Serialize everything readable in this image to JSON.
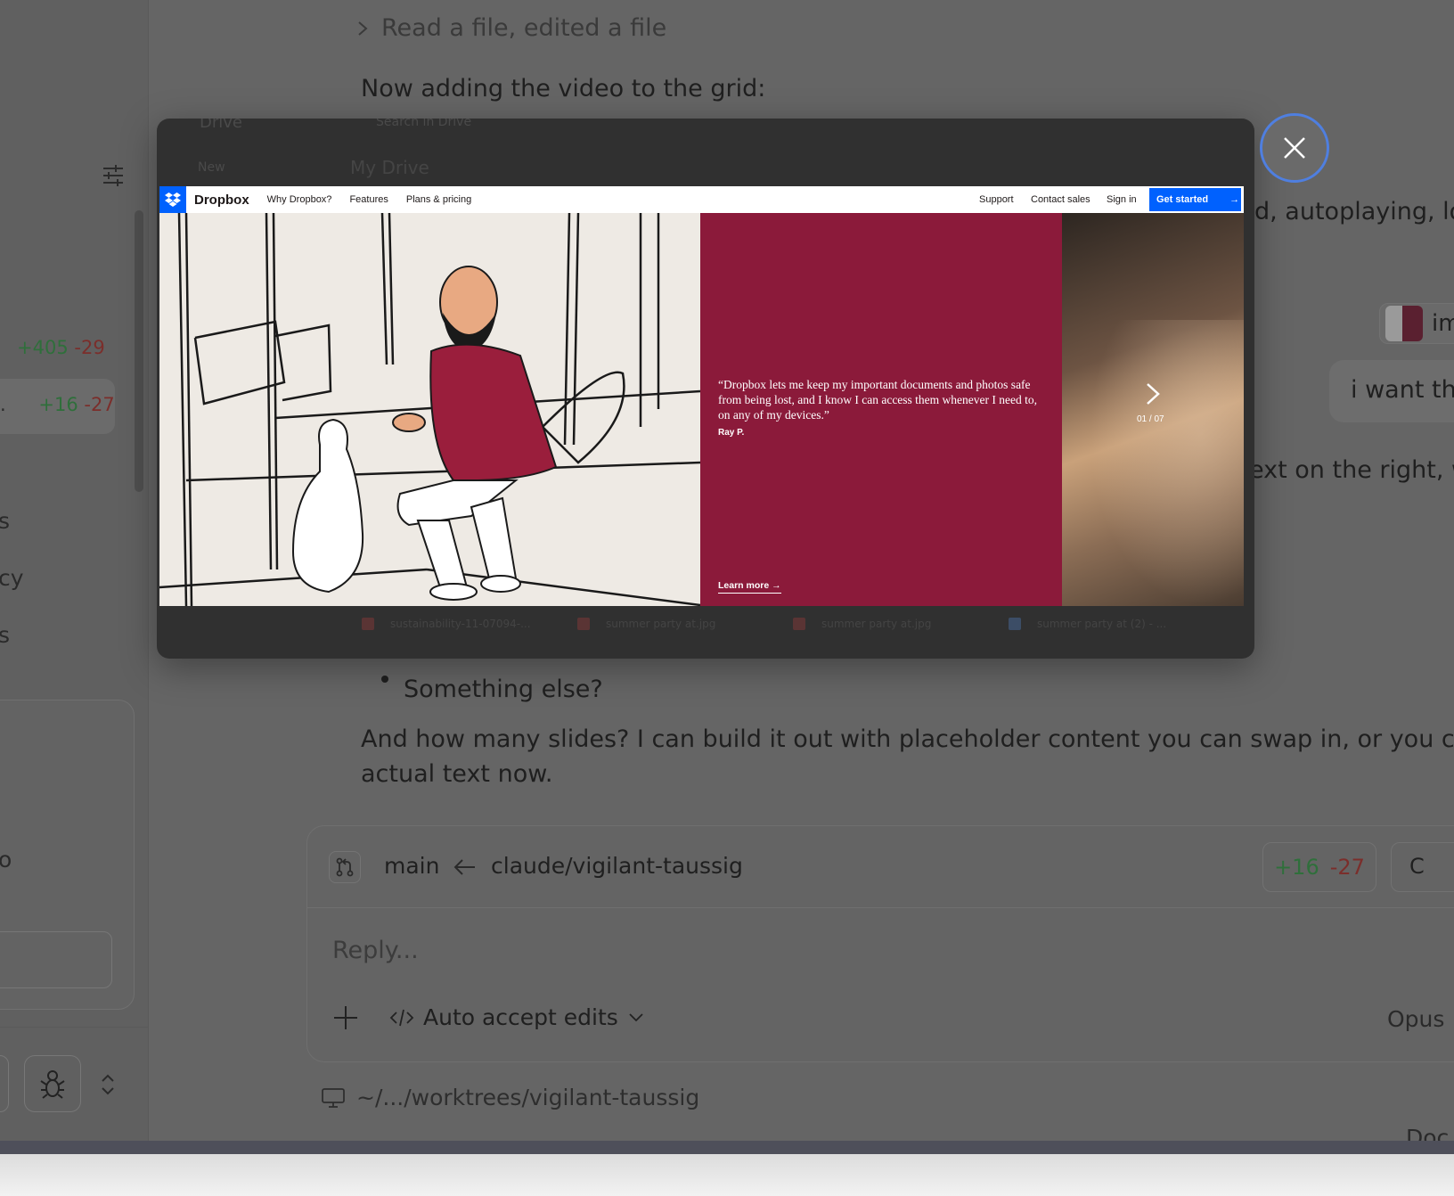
{
  "sidebar": {
    "diff_1": {
      "add": "+405",
      "del": "-29"
    },
    "diff_2": {
      "prefix": ".",
      "add": "+16",
      "del": "-27"
    },
    "cut_texts": [
      "s",
      "cy",
      "s",
      "o"
    ]
  },
  "conversation": {
    "tool_summary": "Read a file, edited a file",
    "line_1": "Now adding the video to the grid:",
    "cut_right_1": "d, autoplaying, loo",
    "attachment_label": "im",
    "user_message": "i want thi",
    "cut_right_2": "ext on the right, w",
    "bullet_item": "Something else?",
    "para_1": "And how many slides? I can build it out with placeholder content you can swap in, or you can gi",
    "para_2": "actual text now."
  },
  "composer": {
    "base_branch": "main",
    "head_branch": "claude/vigilant-taussig",
    "diff_add": "+16",
    "diff_del": "-27",
    "next_button": "C",
    "reply_placeholder": "Reply...",
    "mode_label": "Auto accept edits",
    "model_label": "Opus",
    "path": "~/.../worktrees/vigilant-taussig",
    "bottom_cut": "Doc"
  },
  "modal": {
    "background_ui": {
      "app_name": "Drive",
      "search_placeholder": "Search in Drive",
      "new_label": "New",
      "title": "My Drive",
      "files": [
        "sustainability-11-07094-...",
        "summer party at.jpg",
        "summer party at.jpg",
        "summer party at (2) - ..."
      ]
    },
    "screenshot": {
      "brand": "Dropbox",
      "nav_links": [
        "Why Dropbox?",
        "Features",
        "Plans & pricing"
      ],
      "right_links": [
        "Support",
        "Contact sales",
        "Sign in"
      ],
      "cta": "Get started",
      "quote": "“Dropbox lets me keep my important documents and photos safe from being lost, and I know I can access them whenever I need to, on any of my devices.”",
      "author": "Ray P.",
      "learn_more": "Learn more",
      "slide_counter": "01 / 07"
    }
  },
  "colors": {
    "dropbox_blue": "#0061fe",
    "hero_crimson": "#8b1a3a",
    "close_ring": "#4f7fe0",
    "diff_add": "#2f6f3b",
    "diff_del": "#7b2e2b"
  },
  "icons": [
    "chevron-right-icon",
    "sliders-icon",
    "git-branch-icon",
    "arrow-left-icon",
    "plus-icon",
    "code-icon",
    "chevron-down-icon",
    "monitor-icon",
    "bug-icon",
    "chevron-updown-icon",
    "close-icon",
    "dropbox-logo-icon",
    "arrow-right-icon"
  ]
}
